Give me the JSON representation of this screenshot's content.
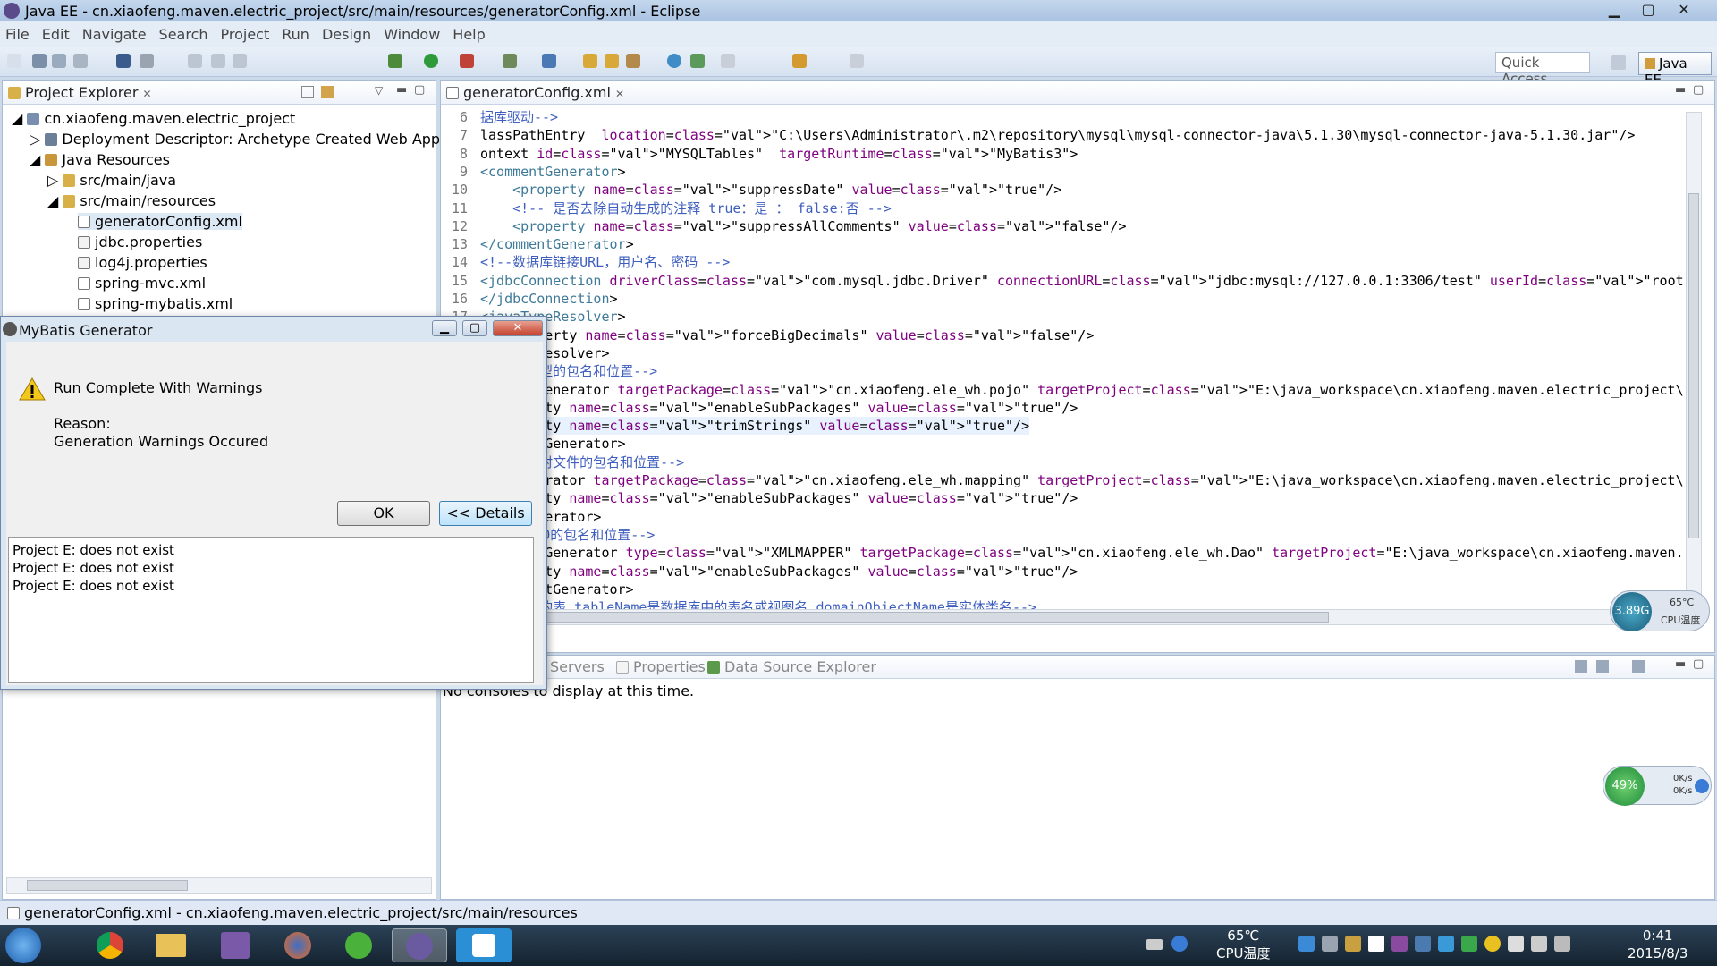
{
  "window": {
    "title": "Java EE - cn.xiaofeng.maven.electric_project/src/main/resources/generatorConfig.xml - Eclipse"
  },
  "menu": [
    "File",
    "Edit",
    "Navigate",
    "Search",
    "Project",
    "Run",
    "Design",
    "Window",
    "Help"
  ],
  "toolbar": {
    "quick_access": "Quick Access",
    "perspective": "Java EE"
  },
  "explorer": {
    "tab_label": "Project Explorer",
    "items": [
      {
        "label": "cn.xiaofeng.maven.electric_project"
      },
      {
        "label": "Deployment Descriptor: Archetype Created Web Applica"
      },
      {
        "label": "Java Resources"
      },
      {
        "label": "src/main/java"
      },
      {
        "label": "src/main/resources"
      },
      {
        "label": "generatorConfig.xml"
      },
      {
        "label": "jdbc.properties"
      },
      {
        "label": "log4j.properties"
      },
      {
        "label": "spring-mvc.xml"
      },
      {
        "label": "spring-mybatis.xml"
      }
    ]
  },
  "editor": {
    "tab_label": "generatorConfig.xml",
    "lines": [
      {
        "n": "6",
        "text": "据库驱动-->"
      },
      {
        "n": "7",
        "text": "lassPathEntry  location=\"C:\\Users\\Administrator\\.m2\\repository\\mysql\\mysql-connector-java\\5.1.30\\mysql-connector-java-5.1.30.jar\"/>"
      },
      {
        "n": "8",
        "text": "ontext id=\"MYSQLTables\"  targetRuntime=\"MyBatis3\">"
      },
      {
        "n": "9",
        "text": "<commentGenerator>"
      },
      {
        "n": "10",
        "text": "    <property name=\"suppressDate\" value=\"true\"/>"
      },
      {
        "n": "11",
        "text": "    <!-- 是否去除自动生成的注释 true：是 ： false:否 -->"
      },
      {
        "n": "12",
        "text": "    <property name=\"suppressAllComments\" value=\"false\"/>"
      },
      {
        "n": "13",
        "text": "</commentGenerator>"
      },
      {
        "n": "14",
        "text": "<!--数据库链接URL，用户名、密码 -->"
      },
      {
        "n": "15",
        "text": "<jdbcConnection driverClass=\"com.mysql.jdbc.Driver\" connectionURL=\"jdbc:mysql://127.0.0.1:3306/test\" userId=\"root\" password=\"123456\">"
      },
      {
        "n": "16",
        "text": "</jdbcConnection>"
      },
      {
        "n": "17",
        "text": "<javaTypeResolver>"
      },
      {
        "n": "",
        "text": "    property name=\"forceBigDecimals\" value=\"false\"/>"
      },
      {
        "n": "",
        "text": "    ypeResolver>"
      },
      {
        "n": "",
        "text": "    成模型的包名和位置-->"
      },
      {
        "n": "",
        "text": "    delGenerator targetPackage=\"cn.xiaofeng.ele_wh.pojo\" targetProject=\"E:\\java_workspace\\cn.xiaofeng.maven.electric_project\\src\">"
      },
      {
        "n": "",
        "text": "    operty name=\"enableSubPackages\" value=\"true\"/>"
      },
      {
        "n": "",
        "text": "    operty name=\"trimStrings\" value=\"true\"/>"
      },
      {
        "n": "",
        "text": "    odelGenerator>"
      },
      {
        "n": "",
        "text": "    成映射文件的包名和位置-->"
      },
      {
        "n": "",
        "text": "    Generator targetPackage=\"cn.xiaofeng.ele_wh.mapping\" targetProject=\"E:\\java_workspace\\cn.xiaofeng.maven.electric_project\\src\">"
      },
      {
        "n": "",
        "text": "    operty name=\"enableSubPackages\" value=\"true\"/>"
      },
      {
        "n": "",
        "text": "    pGenerator>"
      },
      {
        "n": "",
        "text": "    成DAO的包名和位置-->"
      },
      {
        "n": "",
        "text": "    ientGenerator type=\"XMLMAPPER\" targetPackage=\"cn.xiaofeng.ele_wh.Dao\" targetProject=\"E:\\java_workspace\\cn.xiaofeng.maven.electric_project\\src"
      },
      {
        "n": "",
        "text": "    operty name=\"enableSubPackages\" value=\"true\"/>"
      },
      {
        "n": "",
        "text": "    lientGenerator>"
      },
      {
        "n": "",
        "text": "    生成的表 tableName是数据库中的表名或视图名 domainObjectName是实体类名-->"
      }
    ]
  },
  "console": {
    "tabs": [
      "Servers",
      "Properties",
      "Data Source Explorer"
    ],
    "message": "No consoles to display at this time."
  },
  "dialog": {
    "title": "MyBatis Generator",
    "heading": "Run Complete With Warnings",
    "reason_label": "Reason:",
    "reason": "Generation Warnings Occured",
    "ok_label": "OK",
    "details_label": "<< Details",
    "details": [
      "Project E: does not exist",
      "Project E: does not exist",
      "Project E: does not exist"
    ]
  },
  "memory_gauge": {
    "value": "3.89G",
    "temp": "65°C",
    "temp_label": "CPU温度"
  },
  "net_gauge": {
    "percent": "49%",
    "up": "0K/s",
    "down": "0K/s"
  },
  "statusbar": {
    "text": "generatorConfig.xml - cn.xiaofeng.maven.electric_project/src/main/resources"
  },
  "taskbar": {
    "cpu_temp": "65℃",
    "cpu_label": "CPU温度",
    "time": "0:41",
    "date": "2015/8/3"
  },
  "colors": {
    "tag": "#3e7a98",
    "attr": "#7f007f",
    "value": "#2a00ff",
    "comment": "#3f5fbf"
  }
}
